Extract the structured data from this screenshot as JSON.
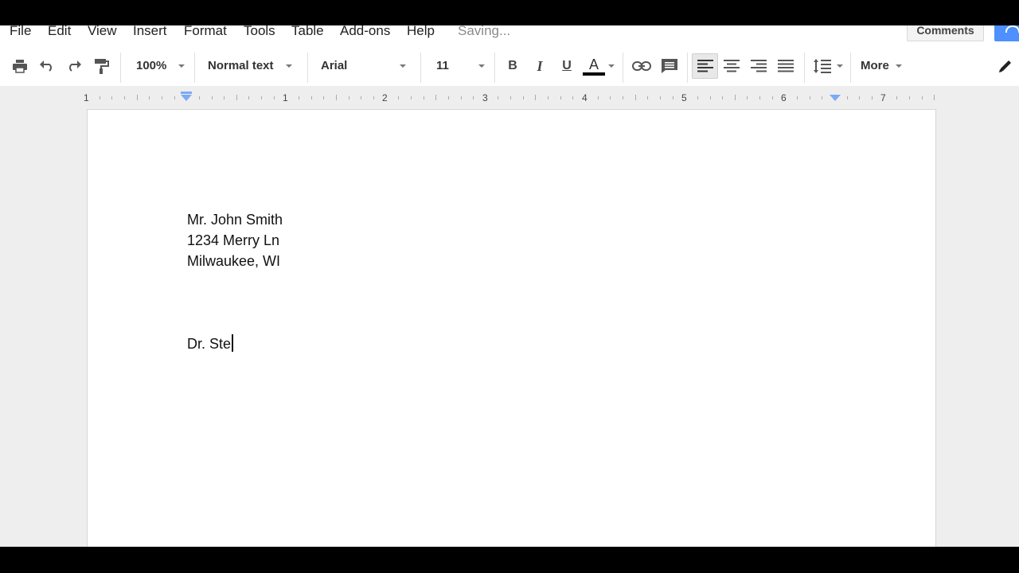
{
  "menu": {
    "items": [
      "File",
      "Edit",
      "View",
      "Insert",
      "Format",
      "Tools",
      "Table",
      "Add-ons",
      "Help"
    ],
    "status": "Saving...",
    "comments_label": "Comments"
  },
  "toolbar": {
    "zoom": "100%",
    "style": "Normal text",
    "font": "Arial",
    "size": "11",
    "bold": "B",
    "italic": "I",
    "underline": "U",
    "text_color": "A",
    "more": "More",
    "icons": [
      "print-icon",
      "undo-icon",
      "redo-icon",
      "paint-format-icon",
      "link-icon",
      "comment-icon",
      "align-left-icon",
      "align-center-icon",
      "align-right-icon",
      "justify-icon",
      "line-spacing-icon",
      "pencil-icon"
    ]
  },
  "ruler": {
    "labels": [
      "1",
      "1",
      "2",
      "3",
      "4",
      "5",
      "6",
      "7"
    ]
  },
  "document": {
    "lines": [
      "Mr. John Smith",
      "1234 Merry Ln",
      "Milwaukee, WI"
    ],
    "current_line": "Dr. Ste"
  },
  "colors": {
    "accent": "#4d90fe",
    "indent_marker": "#7baaf7"
  }
}
